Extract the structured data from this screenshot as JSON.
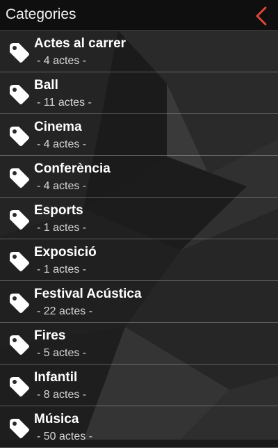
{
  "header": {
    "title": "Categories"
  },
  "colors": {
    "accent": "#e0463c",
    "header_bg": "#0f0f0f"
  },
  "categories": [
    {
      "name": "Actes al carrer",
      "count": "- 4 actes -"
    },
    {
      "name": "Ball",
      "count": "- 11 actes -"
    },
    {
      "name": "Cinema",
      "count": "- 4 actes -"
    },
    {
      "name": "Conferència",
      "count": "- 4 actes -"
    },
    {
      "name": "Esports",
      "count": "- 1 actes -"
    },
    {
      "name": "Exposició",
      "count": "- 1 actes -"
    },
    {
      "name": "Festival Acústica",
      "count": "- 22 actes -"
    },
    {
      "name": "Fires",
      "count": "- 5 actes -"
    },
    {
      "name": "Infantil",
      "count": "- 8 actes -"
    },
    {
      "name": "Música",
      "count": "- 50 actes -"
    }
  ]
}
